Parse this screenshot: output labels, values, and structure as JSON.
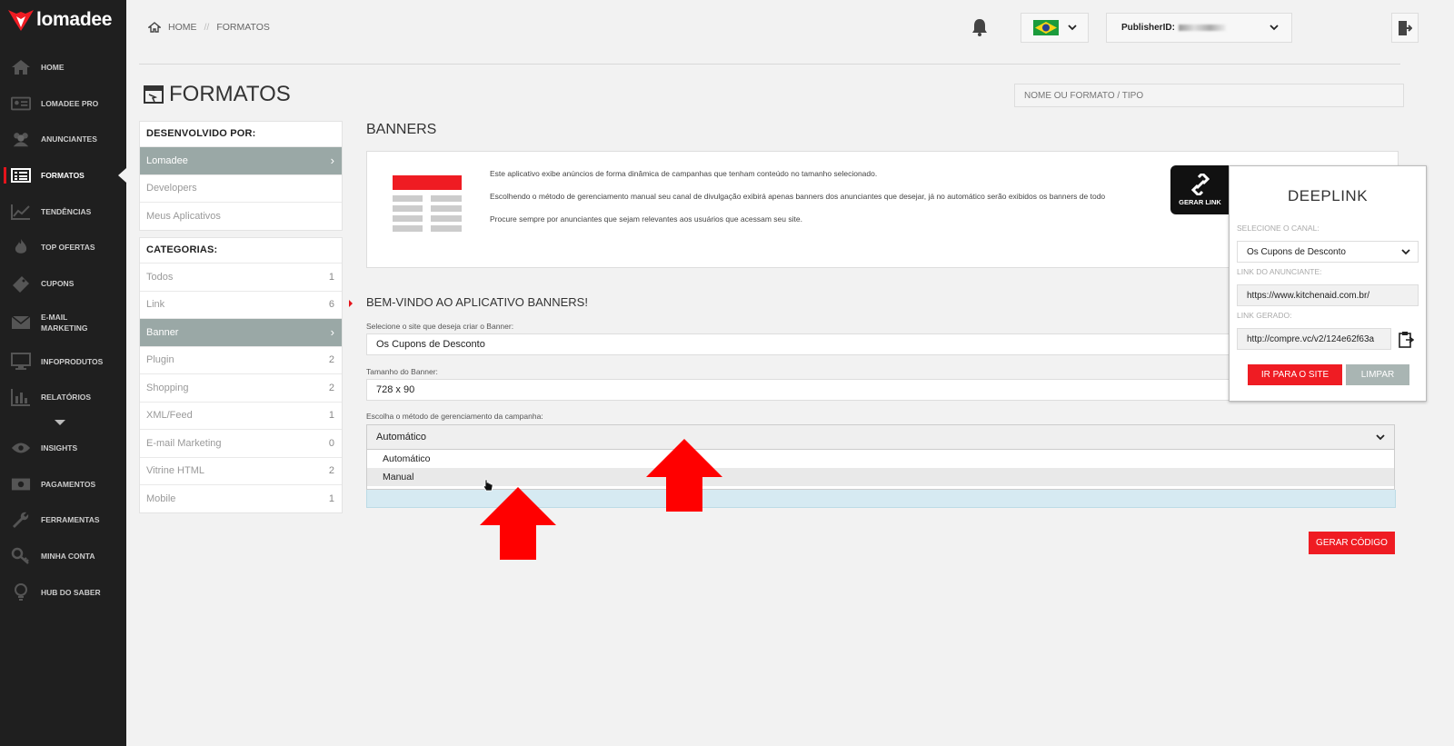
{
  "brand": {
    "name": "lomadee",
    "accent": "#ef1c23",
    "sidebar_bg": "#1f1f1f"
  },
  "sidebar": {
    "items": [
      {
        "label": "HOME",
        "icon": "home-icon"
      },
      {
        "label": "LOMADEE PRO",
        "icon": "id-card-icon"
      },
      {
        "label": "ANUNCIANTES",
        "icon": "users-icon"
      },
      {
        "label": "FORMATOS",
        "icon": "list-icon",
        "active": true
      },
      {
        "label": "TENDÊNCIAS",
        "icon": "trend-line-icon"
      },
      {
        "label": "TOP OFERTAS",
        "icon": "flame-icon"
      },
      {
        "label": "CUPONS",
        "icon": "ticket-icon"
      },
      {
        "label": "E-MAIL MARKETING",
        "icon": "envelope-icon"
      },
      {
        "label": "INFOPRODUTOS",
        "icon": "monitor-icon"
      },
      {
        "label": "RELATÓRIOS",
        "icon": "bar-chart-icon"
      },
      {
        "label": "INSIGHTS",
        "icon": "eye-icon"
      },
      {
        "label": "PAGAMENTOS",
        "icon": "money-icon"
      },
      {
        "label": "FERRAMENTAS",
        "icon": "wrench-icon"
      },
      {
        "label": "MINHA CONTA",
        "icon": "key-icon"
      },
      {
        "label": "HUB DO SABER",
        "icon": "lightbulb-icon"
      }
    ]
  },
  "header": {
    "breadcrumb": {
      "home": "HOME",
      "separator": "//",
      "current": "FORMATOS"
    },
    "publisher_label": "PublisherID:"
  },
  "page": {
    "title": "FORMATOS",
    "search_placeholder": "NOME OU FORMATO / TIPO"
  },
  "developers_panel": {
    "heading": "DESENVOLVIDO POR:",
    "items": [
      {
        "label": "Lomadee",
        "selected": true
      },
      {
        "label": "Developers"
      },
      {
        "label": "Meus Aplicativos"
      }
    ]
  },
  "categories_panel": {
    "heading": "CATEGORIAS:",
    "items": [
      {
        "label": "Todos",
        "count": "1"
      },
      {
        "label": "Link",
        "count": "6"
      },
      {
        "label": "Banner",
        "count": "",
        "selected": true
      },
      {
        "label": "Plugin",
        "count": "2"
      },
      {
        "label": "Shopping",
        "count": "2"
      },
      {
        "label": "XML/Feed",
        "count": "1"
      },
      {
        "label": "E-mail Marketing",
        "count": "0"
      },
      {
        "label": "Vitrine HTML",
        "count": "2"
      },
      {
        "label": "Mobile",
        "count": "1"
      }
    ]
  },
  "main": {
    "section_title": "BANNERS",
    "info_lines": [
      "Este aplicativo exibe anúncios de forma dinâmica de campanhas que tenham conteúdo no tamanho selecionado.",
      "Escolhendo o método de gerenciamento manual seu canal de divulgação exibirá apenas banners dos anunciantes que desejar, já no automático serão exibidos os banners de todo",
      "Procure sempre por anunciantes que sejam relevantes aos usuários que acessam seu site."
    ],
    "welcome": "BEM-VINDO AO APLICATIVO BANNERS!",
    "site_label": "Selecione o site que deseja criar o Banner:",
    "site_value": "Os Cupons de Desconto",
    "size_label": "Tamanho do Banner:",
    "size_value": "728 x 90",
    "method_label": "Escolha o método de gerenciamento da campanha:",
    "method_value": "Automático",
    "method_options": [
      "Automático",
      "Manual"
    ],
    "generate_button": "GERAR CÓDIGO"
  },
  "deeplink": {
    "tab_label": "GERAR LINK",
    "title": "DEEPLINK",
    "channel_label": "SELECIONE O CANAL:",
    "channel_value": "Os Cupons de Desconto",
    "advertiser_link_label": "LINK DO ANUNCIANTE:",
    "advertiser_link_value": "https://www.kitchenaid.com.br/",
    "generated_link_label": "LINK GERADO:",
    "generated_link_value": "http://compre.vc/v2/124e62f63a",
    "go_button": "IR PARA O SITE",
    "clear_button": "LIMPAR"
  }
}
